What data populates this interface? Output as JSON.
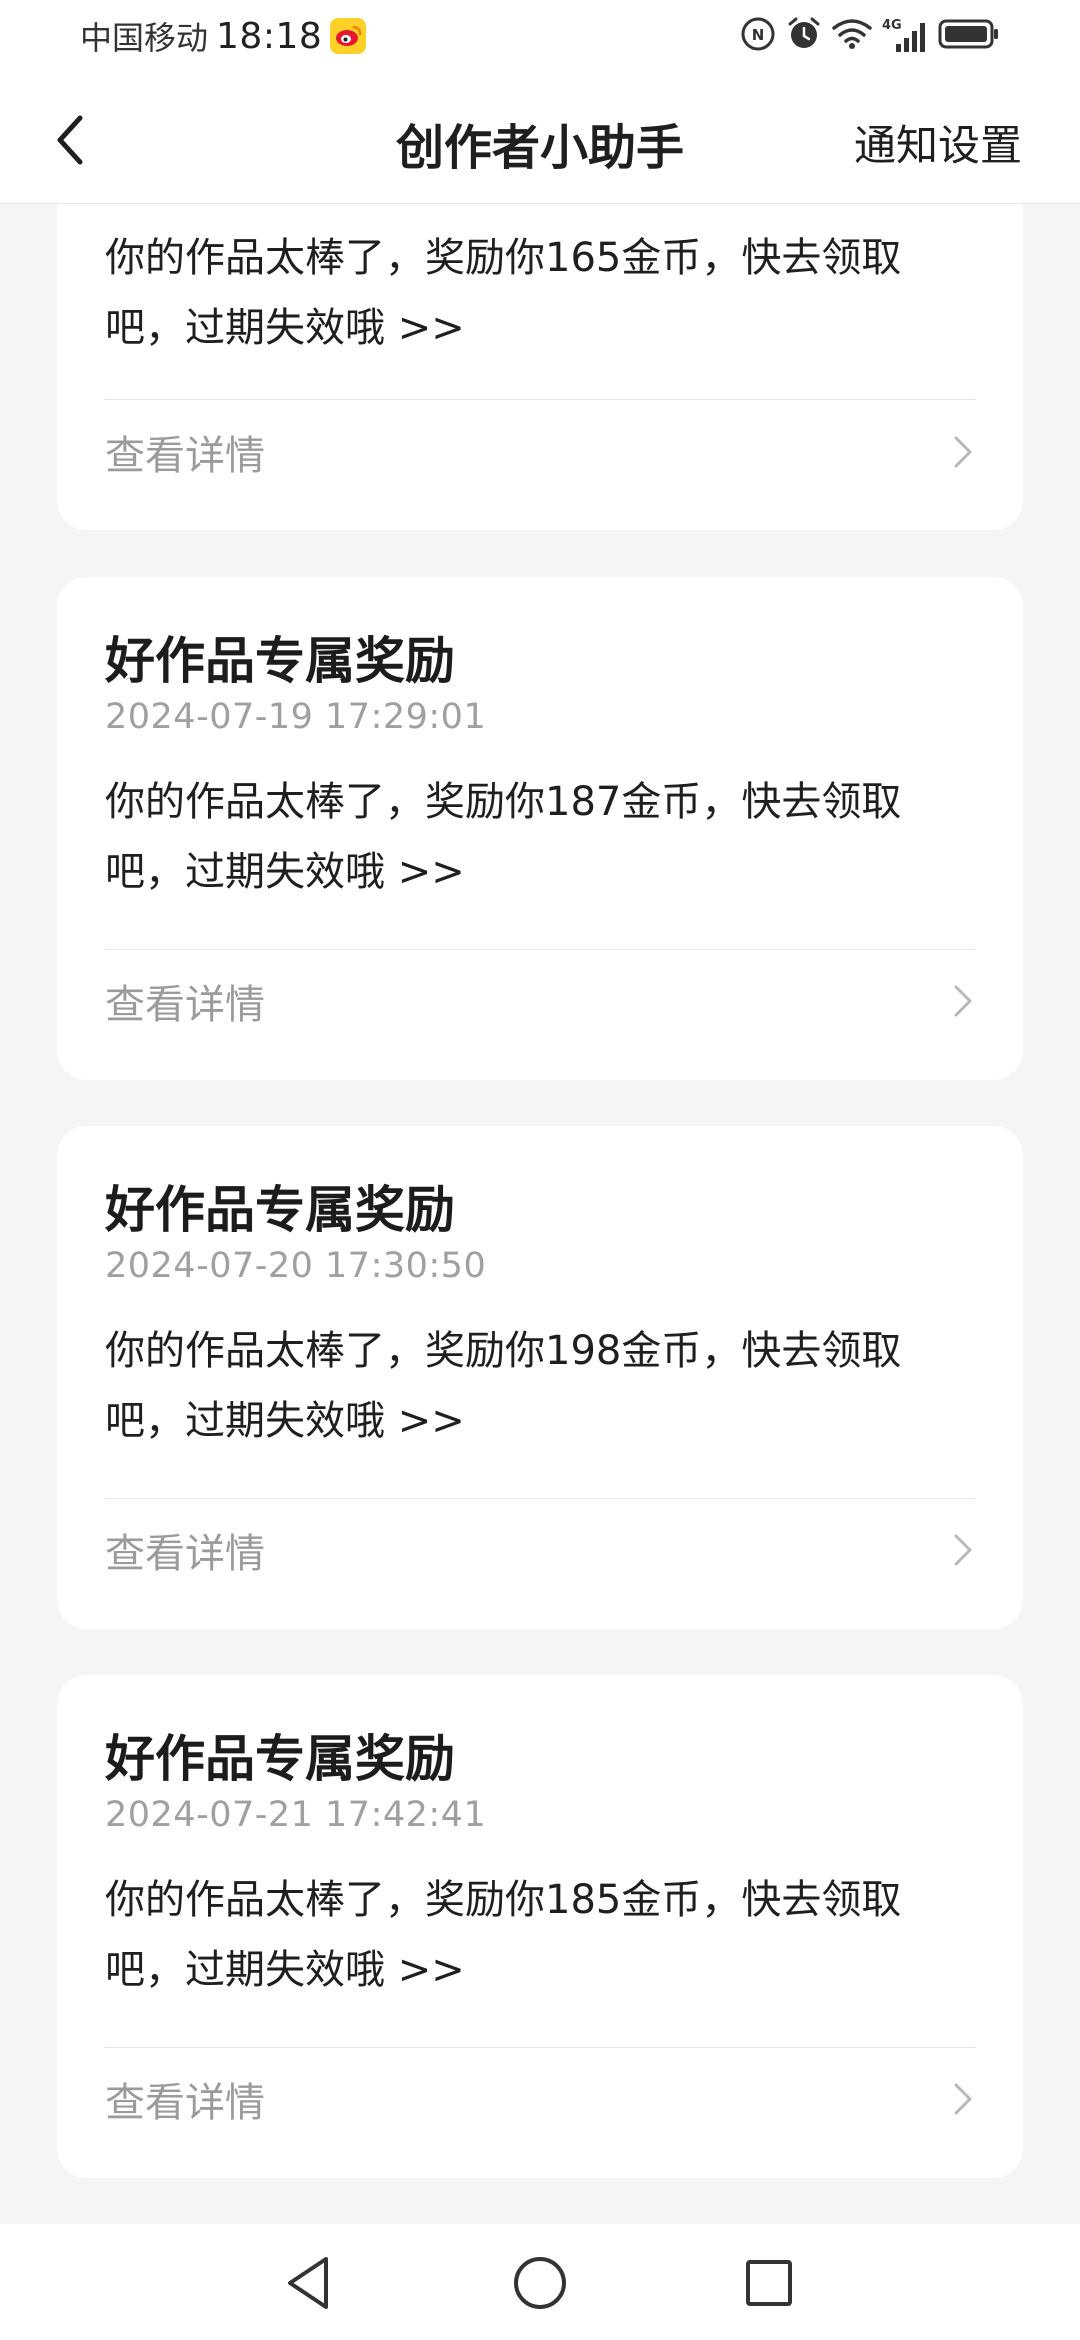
{
  "status_bar": {
    "carrier": "中国移动",
    "time": "18:18",
    "network": "4G"
  },
  "header": {
    "title": "创作者小助手",
    "settings_label": "通知设置"
  },
  "messages": [
    {
      "title": "",
      "time": "",
      "body": "你的作品太棒了，奖励你165金币，快去领取吧，过期失效哦 >>",
      "detail_label": "查看详情"
    },
    {
      "title": "好作品专属奖励",
      "time": "2024-07-19 17:29:01",
      "body": "你的作品太棒了，奖励你187金币，快去领取吧，过期失效哦 >>",
      "detail_label": "查看详情"
    },
    {
      "title": "好作品专属奖励",
      "time": "2024-07-20 17:30:50",
      "body": "你的作品太棒了，奖励你198金币，快去领取吧，过期失效哦 >>",
      "detail_label": "查看详情"
    },
    {
      "title": "好作品专属奖励",
      "time": "2024-07-21 17:42:41",
      "body": "你的作品太棒了，奖励你185金币，快去领取吧，过期失效哦 >>",
      "detail_label": "查看详情"
    }
  ],
  "icons": {
    "back": "chevron-left-icon",
    "detail_arrow": "chevron-right-icon",
    "nav_back": "triangle-back-icon",
    "nav_home": "circle-home-icon",
    "nav_recents": "square-recents-icon"
  }
}
